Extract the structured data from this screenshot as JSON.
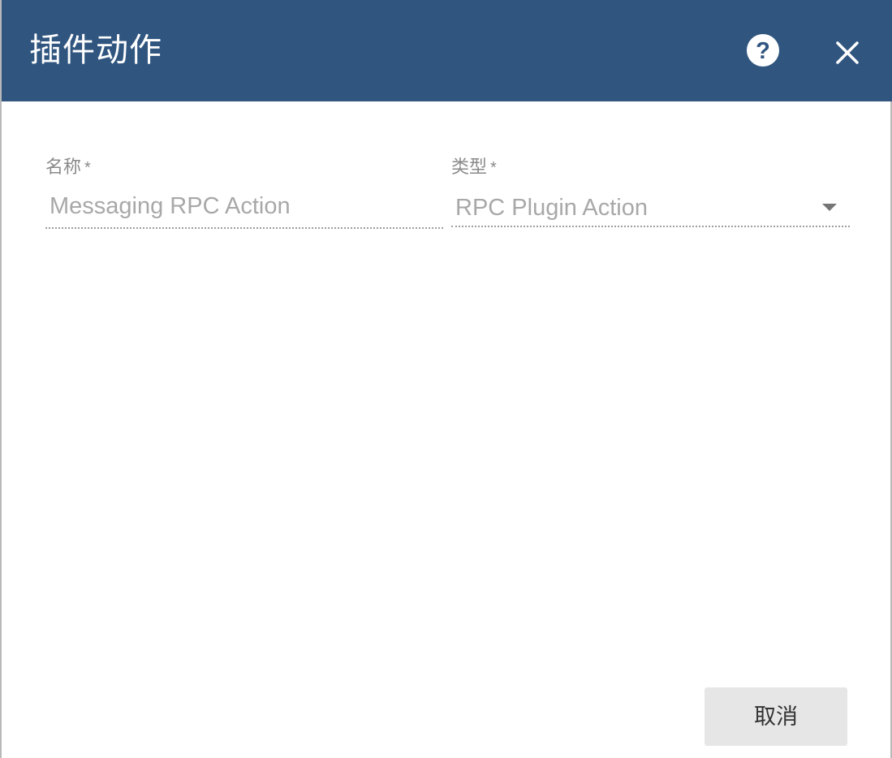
{
  "dialog": {
    "title": "插件动作",
    "help_icon": "help-circle-icon",
    "close_icon": "close-icon",
    "header_color": "#305680"
  },
  "form": {
    "name": {
      "label": "名称",
      "required_marker": "*",
      "value": "Messaging RPC Action"
    },
    "type": {
      "label": "类型",
      "required_marker": "*",
      "value": "RPC Plugin Action",
      "dropdown_icon": "caret-down-icon"
    }
  },
  "footer": {
    "cancel_label": "取消"
  }
}
